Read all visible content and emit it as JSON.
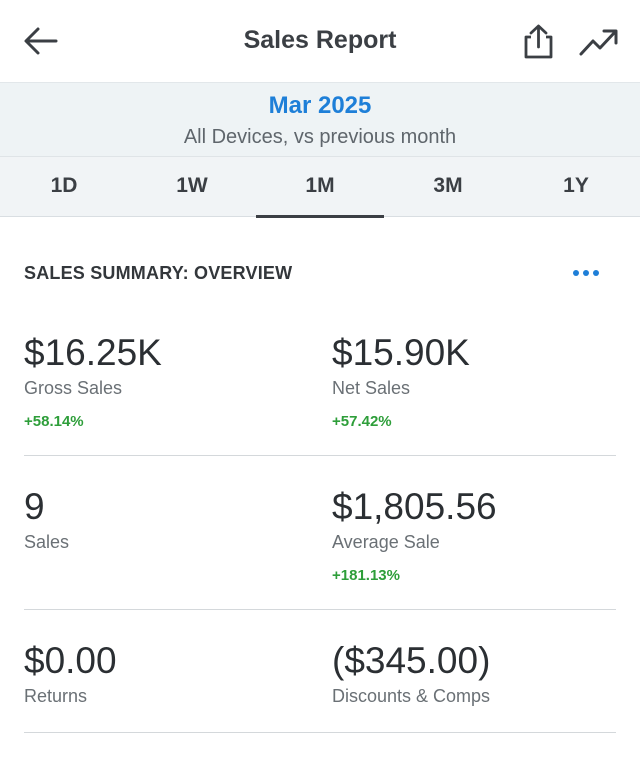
{
  "header": {
    "title": "Sales Report",
    "back_icon": "arrow-left-icon",
    "share_icon": "share-icon",
    "trend_icon": "trending-up-icon"
  },
  "period": {
    "month": "Mar 2025",
    "subtitle": "All Devices, vs previous month"
  },
  "tabs": [
    {
      "label": "1D",
      "active": false
    },
    {
      "label": "1W",
      "active": false
    },
    {
      "label": "1M",
      "active": true
    },
    {
      "label": "3M",
      "active": false
    },
    {
      "label": "1Y",
      "active": false
    }
  ],
  "summary": {
    "title": "SALES SUMMARY: OVERVIEW",
    "more_icon": "more-horizontal-icon",
    "metrics": [
      {
        "value": "$16.25K",
        "label": "Gross Sales",
        "change": "+58.14%"
      },
      {
        "value": "$15.90K",
        "label": "Net Sales",
        "change": "+57.42%"
      },
      {
        "value": "9",
        "label": "Sales",
        "change": ""
      },
      {
        "value": "$1,805.56",
        "label": "Average Sale",
        "change": "+181.13%"
      },
      {
        "value": "$0.00",
        "label": "Returns",
        "change": ""
      },
      {
        "value": "($345.00)",
        "label": "Discounts & Comps",
        "change": ""
      }
    ]
  },
  "colors": {
    "accent": "#1e7fd8",
    "positive": "#2e9e3a",
    "text": "#2b2f33",
    "banner_bg": "#eef3f5"
  }
}
